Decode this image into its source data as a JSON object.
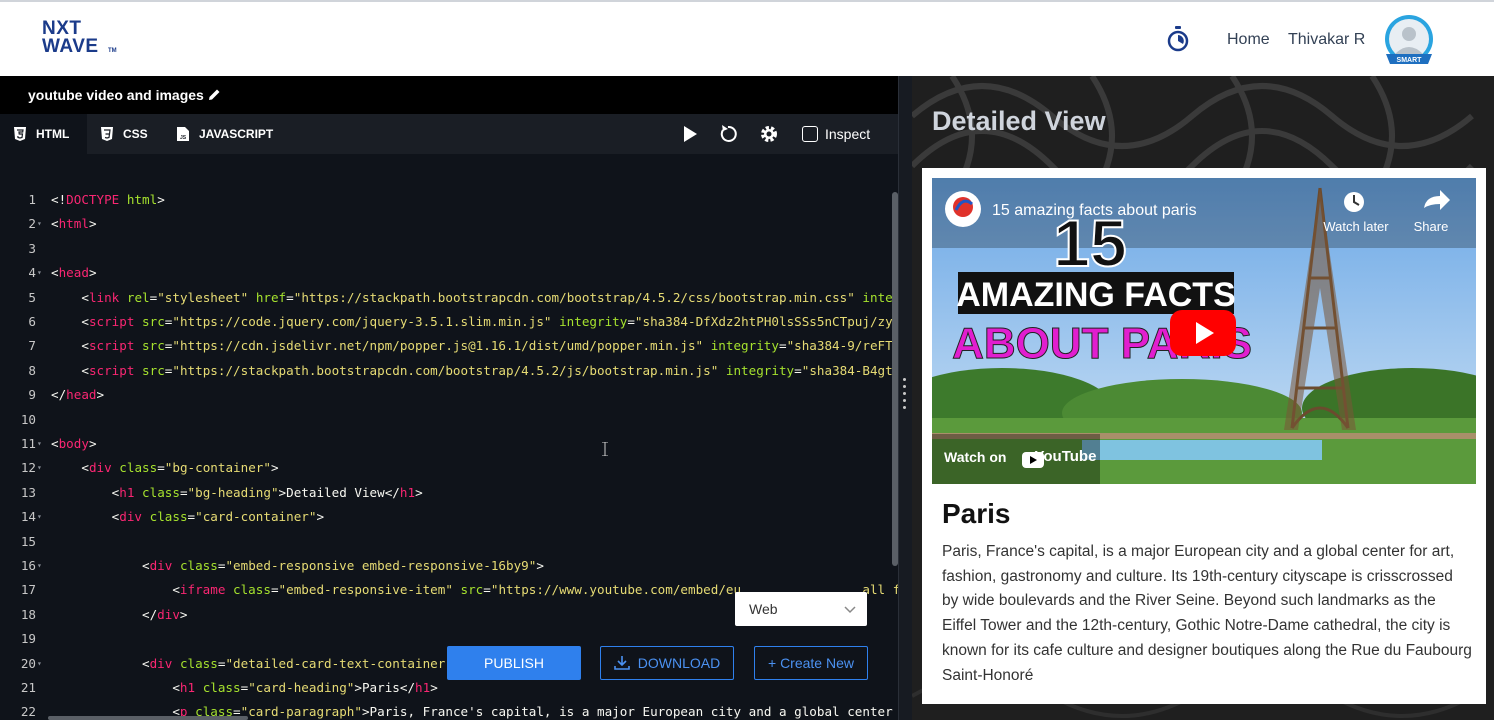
{
  "navbar": {
    "logo_line1": "NXT",
    "logo_line2": "WAVE",
    "logo_tm": "TM",
    "home": "Home",
    "user_name": "Thivakar R",
    "avatar_badge": "SMART"
  },
  "editor": {
    "project_title": "youtube video and images",
    "tabs": [
      {
        "label": "HTML",
        "icon": "html5-icon"
      },
      {
        "label": "CSS",
        "icon": "css3-icon"
      },
      {
        "label": "JAVASCRIPT",
        "icon": "js-file-icon"
      }
    ],
    "inspect_label": "Inspect",
    "code_lines": [
      {
        "n": "1",
        "t": "<!DOCTYPE html>"
      },
      {
        "n": "2",
        "t": "<html>"
      },
      {
        "n": "3",
        "t": ""
      },
      {
        "n": "4",
        "t": "<head>"
      },
      {
        "n": "5",
        "t": "    <link rel=\"stylesheet\" href=\"https://stackpath.bootstrapcdn.com/bootstrap/4.5.2/css/bootstrap.min.css\" inte"
      },
      {
        "n": "6",
        "t": "    <script src=\"https://code.jquery.com/jquery-3.5.1.slim.min.js\" integrity=\"sha384-DfXdz2htPH0lsSSs5nCTpuj/zy"
      },
      {
        "n": "7",
        "t": "    <script src=\"https://cdn.jsdelivr.net/npm/popper.js@1.16.1/dist/umd/popper.min.js\" integrity=\"sha384-9/reFT"
      },
      {
        "n": "8",
        "t": "    <script src=\"https://stackpath.bootstrapcdn.com/bootstrap/4.5.2/js/bootstrap.min.js\" integrity=\"sha384-B4gt"
      },
      {
        "n": "9",
        "t": "</head>"
      },
      {
        "n": "10",
        "t": ""
      },
      {
        "n": "11",
        "t": "<body>"
      },
      {
        "n": "12",
        "t": "    <div class=\"bg-container\">"
      },
      {
        "n": "13",
        "t": "        <h1 class=\"bg-heading\">Detailed View</h1>"
      },
      {
        "n": "14",
        "t": "        <div class=\"card-container\">"
      },
      {
        "n": "15",
        "t": ""
      },
      {
        "n": "16",
        "t": "            <div class=\"embed-responsive embed-responsive-16by9\">"
      },
      {
        "n": "17",
        "t": "                <iframe class=\"embed-responsive-item\" src=\"https://www.youtube.com/embed/eu                all full"
      },
      {
        "n": "18",
        "t": "            </div>"
      },
      {
        "n": "19",
        "t": ""
      },
      {
        "n": "20",
        "t": "            <div class=\"detailed-card-text-container\""
      },
      {
        "n": "21",
        "t": "                <h1 class=\"card-heading\">Paris</h1>"
      },
      {
        "n": "22",
        "t": "                <p class=\"card-paragraph\">Paris, France's capital, is a major European city and a global center"
      }
    ],
    "select_value": "Web",
    "publish_label": "PUBLISH",
    "download_label": "DOWNLOAD",
    "create_label": "+ Create New"
  },
  "preview": {
    "heading": "Detailed View",
    "video": {
      "title": "15 amazing facts about paris",
      "watch_later": "Watch later",
      "share": "Share",
      "watch_on": "Watch on",
      "youtube": "YouTube",
      "thumb_number": "15",
      "thumb_line1": "AMAZING FACTS",
      "thumb_line2": "ABOUT PARIS"
    },
    "card_heading": "Paris",
    "card_paragraph": "Paris, France's capital, is a major European city and a global center for art, fashion, gastronomy and culture. Its 19th-century cityscape is crisscrossed by wide boulevards and the River Seine. Beyond such landmarks as the Eiffel Tower and the 12th-century, Gothic Notre-Dame cathedral, the city is known for its cafe culture and designer boutiques along the Rue du Faubourg Saint-Honoré"
  },
  "colors": {
    "accent": "#2f80ed",
    "editor_bg": "#0f131a",
    "tag": "#f92672",
    "attr": "#a6e22e",
    "string": "#e6db74"
  }
}
